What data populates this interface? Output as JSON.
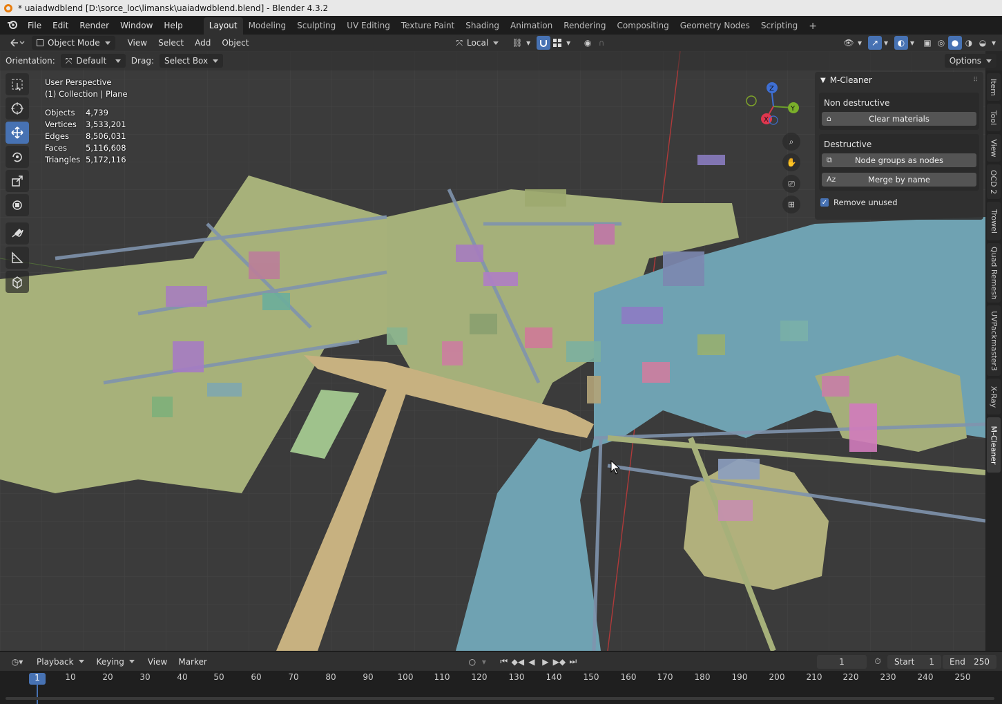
{
  "titlebar": {
    "text": "* uaiadwdblend [D:\\sorce_loc\\limansk\\uaiadwdblend.blend] - Blender 4.3.2"
  },
  "menu": [
    "File",
    "Edit",
    "Render",
    "Window",
    "Help"
  ],
  "workspaces": [
    "Layout",
    "Modeling",
    "Sculpting",
    "UV Editing",
    "Texture Paint",
    "Shading",
    "Animation",
    "Rendering",
    "Compositing",
    "Geometry Nodes",
    "Scripting"
  ],
  "workspace_add": "+",
  "header": {
    "mode": "Object Mode",
    "view": "View",
    "select": "Select",
    "add": "Add",
    "object": "Object",
    "pivot": "Local"
  },
  "header2": {
    "orientation_label": "Orientation:",
    "orientation_value": "Default",
    "drag_label": "Drag:",
    "drag_value": "Select Box",
    "options": "Options"
  },
  "viewport": {
    "perspective": "User Perspective",
    "collection": "(1) Collection | Plane",
    "stats": [
      {
        "k": "Objects",
        "v": "4,739"
      },
      {
        "k": "Vertices",
        "v": "3,533,201"
      },
      {
        "k": "Edges",
        "v": "8,506,031"
      },
      {
        "k": "Faces",
        "v": "5,116,608"
      },
      {
        "k": "Triangles",
        "v": "5,172,116"
      }
    ]
  },
  "gizmo": {
    "z": "Z",
    "y": "Y",
    "x": "X"
  },
  "npanel": {
    "title": "M-Cleaner",
    "non_destructive": "Non destructive",
    "clear_materials": "Clear materials",
    "destructive": "Destructive",
    "node_groups": "Node groups as nodes",
    "merge_by_name": "Merge by name",
    "remove_unused": "Remove unused"
  },
  "side_tabs": [
    "Item",
    "Tool",
    "View",
    "OCD 2",
    "Trowel",
    "Quad Remesh",
    "UVPackmaster3",
    "X-Ray",
    "M-Cleaner"
  ],
  "timeline": {
    "playback": "Playback",
    "keying": "Keying",
    "view": "View",
    "marker": "Marker",
    "current_frame": "1",
    "start_label": "Start",
    "start": "1",
    "end_label": "End",
    "end": "250",
    "ticks": [
      "1",
      "10",
      "20",
      "30",
      "40",
      "50",
      "60",
      "70",
      "80",
      "90",
      "100",
      "110",
      "120",
      "130",
      "140",
      "150",
      "160",
      "170",
      "180",
      "190",
      "200",
      "210",
      "220",
      "230",
      "240",
      "250"
    ]
  },
  "colors": {
    "accent": "#4772b3",
    "ground": "#a9b57a",
    "water": "#6fa3b3",
    "roads": "#7d8ea8"
  }
}
